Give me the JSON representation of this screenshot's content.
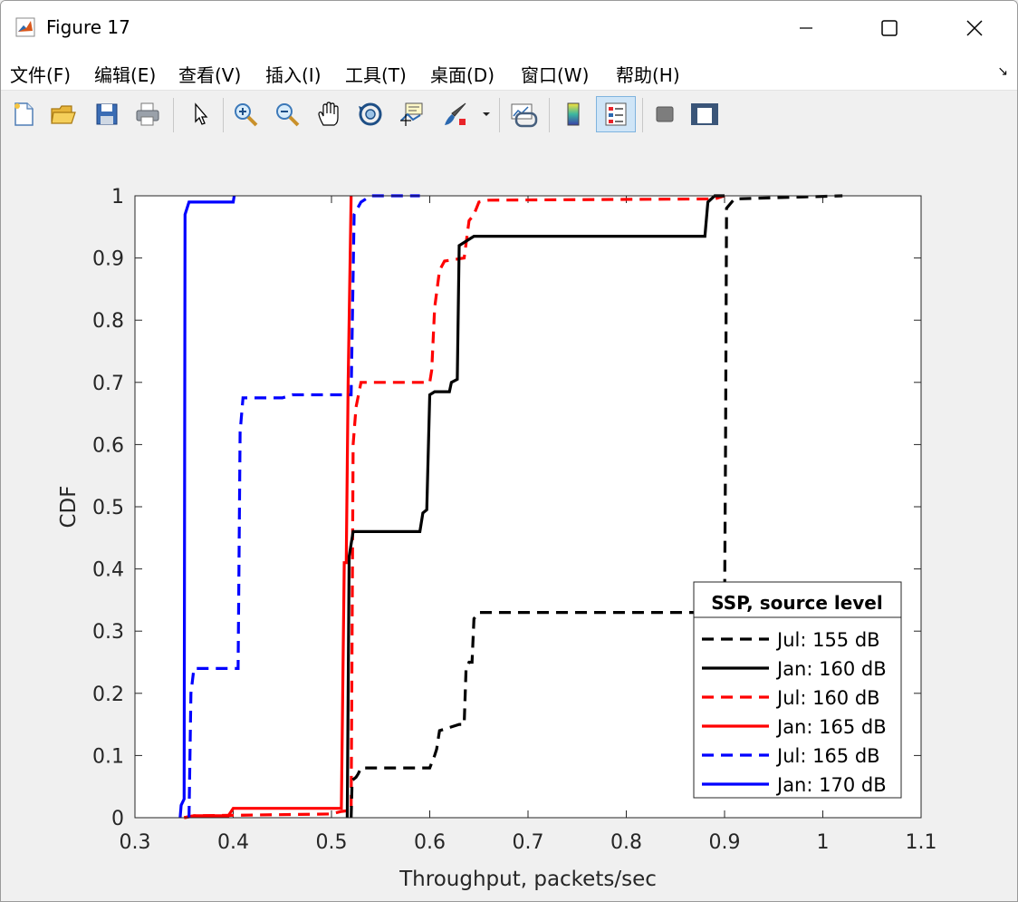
{
  "window": {
    "title": "Figure 17"
  },
  "menu": {
    "items": [
      "文件(F)",
      "编辑(E)",
      "查看(V)",
      "插入(I)",
      "工具(T)",
      "桌面(D)",
      "窗口(W)",
      "帮助(H)"
    ]
  },
  "toolbar": {
    "icons": [
      "new-figure-icon",
      "open-icon",
      "save-icon",
      "print-icon",
      "pointer-icon",
      "zoom-in-icon",
      "zoom-out-icon",
      "pan-hand-icon",
      "rotate-3d-icon",
      "data-cursor-icon",
      "brush-icon",
      "link-plot-icon",
      "colorbar-icon",
      "legend-icon",
      "hide-plot-tools-icon",
      "show-plot-tools-icon"
    ]
  },
  "colors": {
    "black": "#000000",
    "red": "#ff0000",
    "blue": "#0000ff"
  },
  "chart_data": {
    "type": "line",
    "title": "",
    "xlabel": "Throughput, packets/sec",
    "ylabel": "CDF",
    "xlim": [
      0.3,
      1.1
    ],
    "ylim": [
      0,
      1
    ],
    "xticks": [
      "0.3",
      "0.4",
      "0.5",
      "0.6",
      "0.7",
      "0.8",
      "0.9",
      "1",
      "1.1"
    ],
    "yticks": [
      "0",
      "0.1",
      "0.2",
      "0.3",
      "0.4",
      "0.5",
      "0.6",
      "0.7",
      "0.8",
      "0.9",
      "1"
    ],
    "grid": false,
    "legend": {
      "title": "SSP, source level",
      "position": "bottom-right"
    },
    "series": [
      {
        "name": "Jul: 155 dB",
        "color": "#000000",
        "dash": "dashed",
        "points": [
          [
            0.52,
            0
          ],
          [
            0.521,
            0.06
          ],
          [
            0.525,
            0.065
          ],
          [
            0.527,
            0.07
          ],
          [
            0.53,
            0.08
          ],
          [
            0.6,
            0.08
          ],
          [
            0.605,
            0.1
          ],
          [
            0.607,
            0.11
          ],
          [
            0.61,
            0.14
          ],
          [
            0.63,
            0.15
          ],
          [
            0.635,
            0.15
          ],
          [
            0.637,
            0.24
          ],
          [
            0.64,
            0.25
          ],
          [
            0.643,
            0.25
          ],
          [
            0.645,
            0.32
          ],
          [
            0.65,
            0.33
          ],
          [
            0.9,
            0.33
          ],
          [
            0.901,
            0.6
          ],
          [
            0.902,
            0.98
          ],
          [
            0.91,
            0.995
          ],
          [
            1.02,
            1.0
          ]
        ]
      },
      {
        "name": "Jan: 160 dB",
        "color": "#000000",
        "dash": "solid",
        "points": [
          [
            0.516,
            0
          ],
          [
            0.518,
            0.42
          ],
          [
            0.522,
            0.46
          ],
          [
            0.59,
            0.46
          ],
          [
            0.593,
            0.49
          ],
          [
            0.597,
            0.495
          ],
          [
            0.6,
            0.68
          ],
          [
            0.605,
            0.685
          ],
          [
            0.62,
            0.685
          ],
          [
            0.622,
            0.7
          ],
          [
            0.628,
            0.705
          ],
          [
            0.63,
            0.92
          ],
          [
            0.64,
            0.93
          ],
          [
            0.645,
            0.935
          ],
          [
            0.88,
            0.935
          ],
          [
            0.883,
            0.99
          ],
          [
            0.89,
            1.0
          ],
          [
            0.9,
            1.0
          ]
        ]
      },
      {
        "name": "Jul: 160 dB",
        "color": "#ff0000",
        "dash": "dashed",
        "points": [
          [
            0.35,
            0
          ],
          [
            0.36,
            0.003
          ],
          [
            0.5,
            0.006
          ],
          [
            0.51,
            0.01
          ],
          [
            0.52,
            0.012
          ],
          [
            0.522,
            0.6
          ],
          [
            0.525,
            0.66
          ],
          [
            0.53,
            0.7
          ],
          [
            0.6,
            0.7
          ],
          [
            0.602,
            0.72
          ],
          [
            0.605,
            0.82
          ],
          [
            0.61,
            0.88
          ],
          [
            0.615,
            0.895
          ],
          [
            0.635,
            0.9
          ],
          [
            0.64,
            0.96
          ],
          [
            0.645,
            0.97
          ],
          [
            0.65,
            0.99
          ],
          [
            0.66,
            0.993
          ],
          [
            0.89,
            0.995
          ],
          [
            0.9,
            1.0
          ]
        ]
      },
      {
        "name": "Jan: 165 dB",
        "color": "#ff0000",
        "dash": "solid",
        "points": [
          [
            0.35,
            0
          ],
          [
            0.36,
            0.003
          ],
          [
            0.395,
            0.003
          ],
          [
            0.4,
            0.015
          ],
          [
            0.51,
            0.015
          ],
          [
            0.513,
            0.41
          ],
          [
            0.515,
            0.41
          ],
          [
            0.517,
            0.7
          ],
          [
            0.52,
            1.0
          ]
        ]
      },
      {
        "name": "Jul: 165 dB",
        "color": "#0000ff",
        "dash": "dashed",
        "points": [
          [
            0.355,
            0
          ],
          [
            0.357,
            0.2
          ],
          [
            0.36,
            0.24
          ],
          [
            0.405,
            0.24
          ],
          [
            0.407,
            0.62
          ],
          [
            0.41,
            0.675
          ],
          [
            0.45,
            0.675
          ],
          [
            0.46,
            0.68
          ],
          [
            0.52,
            0.68
          ],
          [
            0.523,
            0.97
          ],
          [
            0.53,
            0.99
          ],
          [
            0.54,
            1.0
          ],
          [
            0.59,
            1.0
          ]
        ]
      },
      {
        "name": "Jan: 170 dB",
        "color": "#0000ff",
        "dash": "solid",
        "points": [
          [
            0.346,
            0
          ],
          [
            0.347,
            0.02
          ],
          [
            0.35,
            0.03
          ],
          [
            0.351,
            0.97
          ],
          [
            0.355,
            0.99
          ],
          [
            0.4,
            0.99
          ],
          [
            0.401,
            1.0
          ]
        ]
      }
    ]
  }
}
